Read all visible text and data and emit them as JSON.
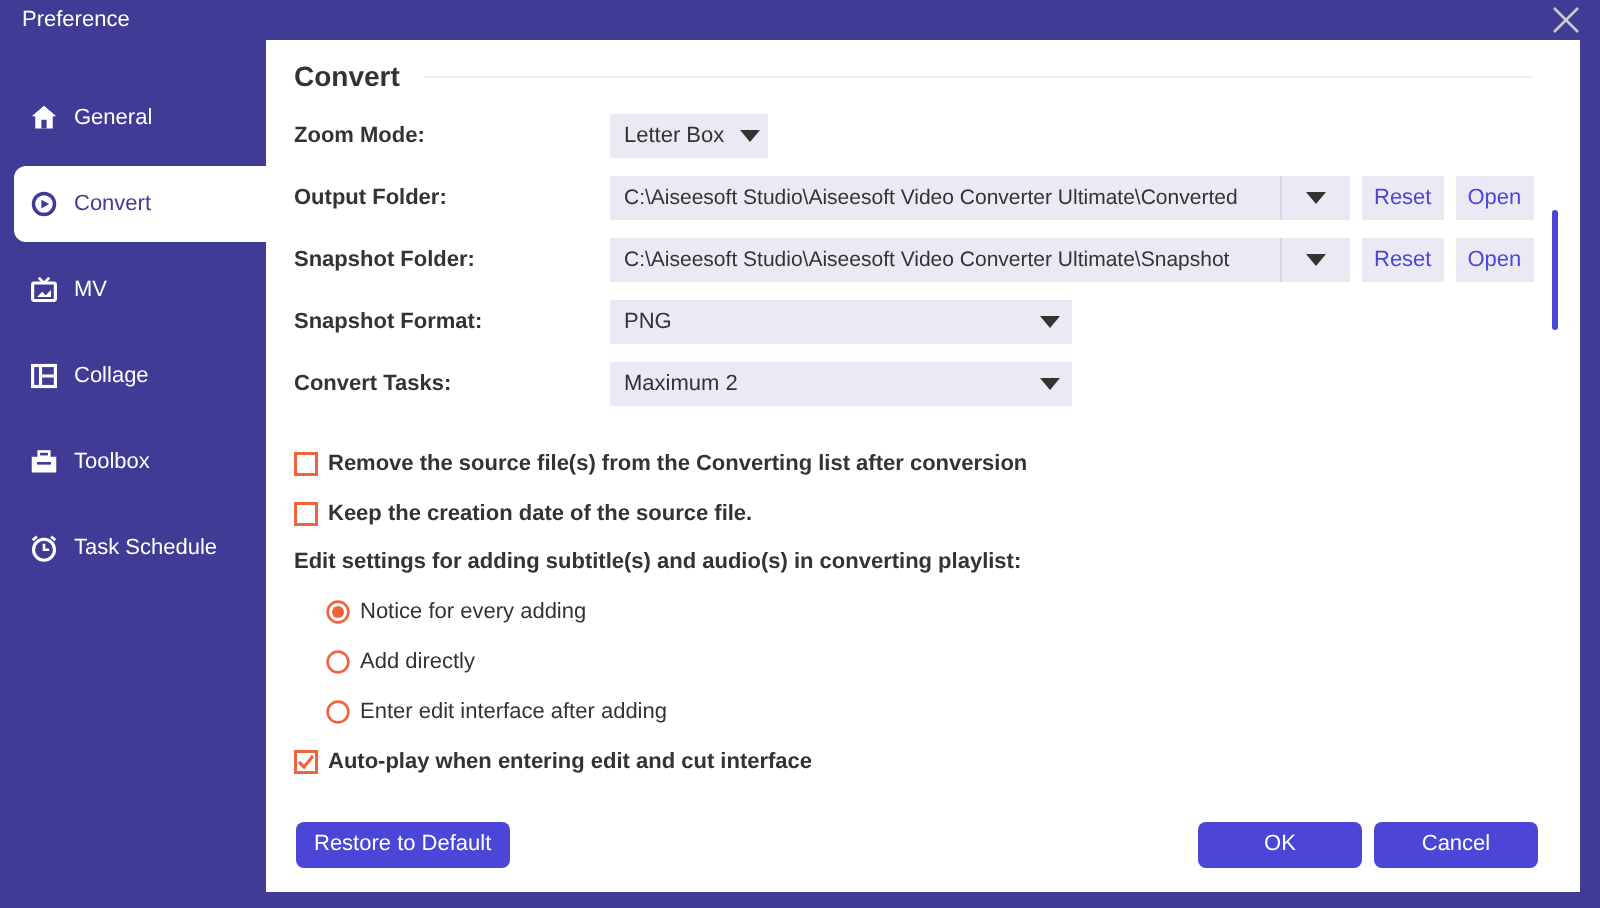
{
  "window": {
    "title": "Preference"
  },
  "sidebar": {
    "items": [
      {
        "label": "General",
        "kind": "home",
        "selected": false
      },
      {
        "label": "Convert",
        "kind": "convert",
        "selected": true
      },
      {
        "label": "MV",
        "kind": "tv",
        "selected": false
      },
      {
        "label": "Collage",
        "kind": "collage",
        "selected": false
      },
      {
        "label": "Toolbox",
        "kind": "toolbox",
        "selected": false
      },
      {
        "label": "Task Schedule",
        "kind": "clock",
        "selected": false
      }
    ]
  },
  "section": {
    "title": "Convert"
  },
  "settings": [
    {
      "label": "Zoom Mode:",
      "kind": "small",
      "value": "Letter Box"
    },
    {
      "label": "Output Folder:",
      "kind": "path",
      "value": "C:\\Aiseesoft Studio\\Aiseesoft Video Converter Ultimate\\Converted",
      "buttons": [
        "Reset",
        "Open"
      ]
    },
    {
      "label": "Snapshot Folder:",
      "kind": "path",
      "value": "C:\\Aiseesoft Studio\\Aiseesoft Video Converter Ultimate\\Snapshot",
      "buttons": [
        "Reset",
        "Open"
      ]
    },
    {
      "label": "Snapshot Format:",
      "kind": "wide",
      "value": "PNG"
    },
    {
      "label": "Convert Tasks:",
      "kind": "wide",
      "value": "Maximum 2"
    }
  ],
  "options": [
    {
      "kind": "checkbox",
      "label": "Remove the source file(s) from the Converting list after conversion",
      "checked": false
    },
    {
      "kind": "checkbox",
      "label": "Keep the creation date of the source file.",
      "checked": false
    },
    {
      "kind": "heading",
      "label": "Edit settings for adding subtitle(s) and audio(s) in converting playlist:"
    },
    {
      "kind": "radio",
      "label": "Notice for every adding",
      "selected": true
    },
    {
      "kind": "radio",
      "label": "Add directly",
      "selected": false
    },
    {
      "kind": "radio",
      "label": "Enter edit interface after adding",
      "selected": false
    },
    {
      "kind": "checkbox",
      "label": "Auto-play when entering edit and cut interface",
      "checked": true
    }
  ],
  "footer": {
    "restore": "Restore to Default",
    "ok": "OK",
    "cancel": "Cancel"
  }
}
